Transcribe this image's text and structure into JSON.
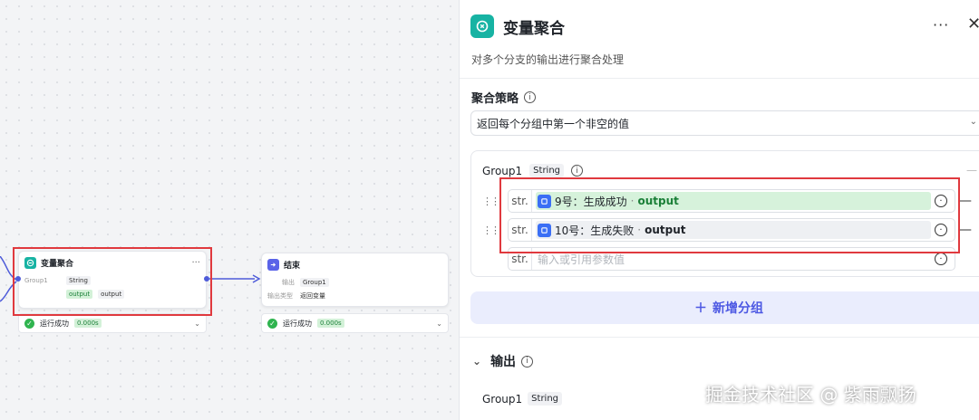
{
  "canvas": {
    "agg_node": {
      "title": "变量聚合",
      "more": "···",
      "group_label": "Group1",
      "group_type": "String",
      "output_ref": "output",
      "output_name": "output",
      "status": "运行成功",
      "time": "0.000s"
    },
    "end_node": {
      "title": "结束",
      "out_label": "输出",
      "out_value": "Group1",
      "type_label": "输出类型",
      "type_value": "返回变量",
      "status": "运行成功",
      "time": "0.000s"
    }
  },
  "panel": {
    "title": "变量聚合",
    "more": "···",
    "close": "✕",
    "description": "对多个分支的输出进行聚合处理",
    "strategy_label": "聚合策略",
    "strategy_value": "返回每个分组中第一个非空的值",
    "group": {
      "name": "Group1",
      "type": "String",
      "vars": [
        {
          "type": "str.",
          "node": "9号：生成成功",
          "sep": "·",
          "out": "output"
        },
        {
          "type": "str.",
          "node": "10号：生成失败",
          "sep": "·",
          "out": "output"
        }
      ],
      "new_var_type": "str.",
      "placeholder": "输入或引用参数值"
    },
    "add_group": "新增分组",
    "output_label": "输出",
    "output_name": "Group1",
    "output_type": "String"
  },
  "watermark": "掘金技术社区 @ 紫雨飘扬",
  "colors": {
    "accent": "#4c58e3",
    "brand_teal": "#17b3a3",
    "success": "#2fb44f",
    "highlight": "#e0393e"
  }
}
